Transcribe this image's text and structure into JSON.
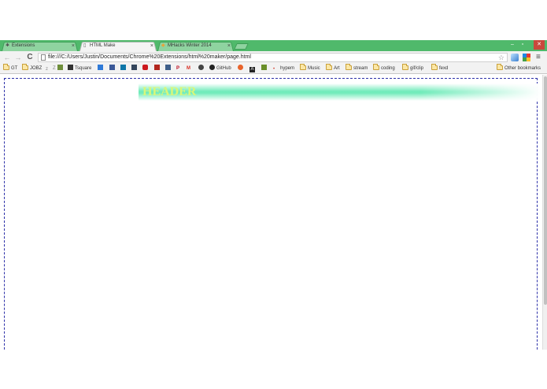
{
  "tabs": [
    {
      "label": "Extensions",
      "icon": "puzzle-icon",
      "close": "×"
    },
    {
      "label": "HTML Make",
      "icon": "page-icon",
      "close": "×",
      "active": true
    },
    {
      "label": "MHacks Winter 2014",
      "icon": "mhacks-icon",
      "close": "×"
    }
  ],
  "window_controls": {
    "minimize": "–",
    "maximize": "▫",
    "close": "✕"
  },
  "toolbar": {
    "back": "←",
    "forward": "→",
    "reload": "C",
    "url": "file:///C:/Users/Justin/Documents/Chrome%20Extensions/html%20maker/page.html",
    "star": "☆",
    "menu": "≡"
  },
  "bookmarks": [
    {
      "label": "GT",
      "type": "folder"
    },
    {
      "label": "JOBZ",
      "type": "folder"
    },
    {
      "label": "Z",
      "type": "icon",
      "icon": "zz-icon"
    },
    {
      "label": "",
      "type": "icon",
      "icon": "check-icon",
      "color": "#6f8f3b"
    },
    {
      "label": "Tsquare",
      "type": "icon",
      "icon": "tsquare-icon",
      "color": "#333333"
    },
    {
      "label": "",
      "type": "icon",
      "icon": "dropbox-icon",
      "color": "#2f7ad8"
    },
    {
      "label": "",
      "type": "icon",
      "icon": "facebook-icon",
      "color": "#3b5998"
    },
    {
      "label": "",
      "type": "icon",
      "icon": "linkedin-icon",
      "color": "#0e76a8"
    },
    {
      "label": "",
      "type": "icon",
      "icon": "tumblr-icon",
      "color": "#35465c"
    },
    {
      "label": "",
      "type": "icon",
      "icon": "youtube-icon",
      "color": "#cc181e"
    },
    {
      "label": "",
      "type": "icon",
      "icon": "red-app-icon",
      "color": "#b3261e"
    },
    {
      "label": "",
      "type": "icon",
      "icon": "chart-app-icon",
      "color": "#3f5f8a"
    },
    {
      "label": "P",
      "type": "icon",
      "icon": "pinterest-icon",
      "color": "#bd081c"
    },
    {
      "label": "M",
      "type": "icon",
      "icon": "gmail-icon",
      "color": "#d93025"
    },
    {
      "label": "",
      "type": "icon",
      "icon": "reddit-icon",
      "color": "#444444"
    },
    {
      "label": "GitHub",
      "type": "icon",
      "icon": "github-icon",
      "color": "#222222"
    },
    {
      "label": "",
      "type": "icon",
      "icon": "orange-app-icon",
      "color": "#e8632b"
    },
    {
      "label": "A",
      "type": "icon",
      "icon": "a-app-icon",
      "color": "#222222"
    },
    {
      "label": "",
      "type": "icon",
      "icon": "green-app-icon",
      "color": "#6a8f2a"
    },
    {
      "label": "hypem",
      "type": "icon",
      "icon": "hypem-icon",
      "color": "#d13a2b"
    },
    {
      "label": "Music",
      "type": "folder"
    },
    {
      "label": "Art",
      "type": "folder"
    },
    {
      "label": "stream",
      "type": "folder"
    },
    {
      "label": "coding",
      "type": "folder"
    },
    {
      "label": "gif/clip",
      "type": "folder"
    },
    {
      "label": "fexd",
      "type": "folder"
    }
  ],
  "other_bookmarks": "Other bookmarks",
  "page": {
    "header_text": "HEADER",
    "header_text_color": "#d8f77a",
    "header_bar_color": "#5ae8af",
    "canvas_border_color": "#2b2fa8"
  }
}
